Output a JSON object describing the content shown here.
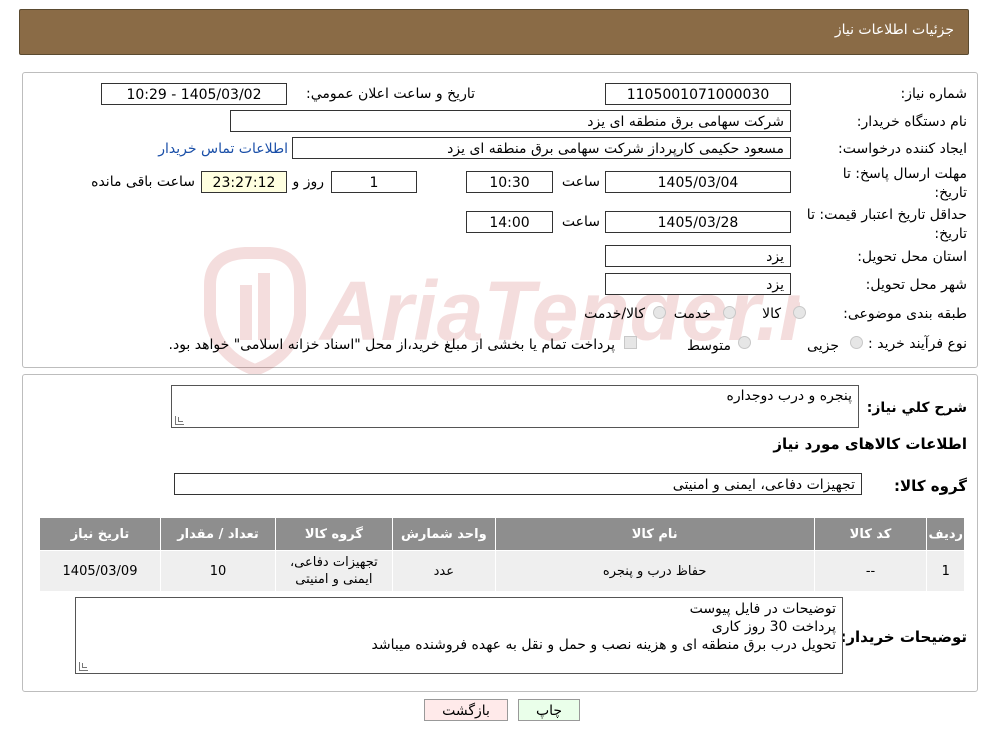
{
  "header": {
    "title": "جزئیات اطلاعات نیاز"
  },
  "form": {
    "need_number_label": "شماره نیاز:",
    "need_number": "1105001071000030",
    "announce_label": "تاريخ و ساعت اعلان عمومي:",
    "announce_value": "1405/03/02 - 10:29",
    "buyer_org_label": "نام دستگاه خریدار:",
    "buyer_org": "شرکت سهامی برق منطقه ای یزد",
    "creator_label": "ایجاد کننده درخواست:",
    "creator": "مسعود حکیمی کارپرداز شرکت سهامی برق منطقه ای یزد",
    "contact_link": "اطلاعات تماس خریدار",
    "deadline_label": "مهلت ارسال پاسخ: تا تاریخ:",
    "deadline_date": "1405/03/04",
    "time_label": "ساعت",
    "deadline_time": "10:30",
    "remaining_days": "1",
    "day_and_label": "روز و",
    "remaining_time": "23:27:12",
    "remaining_label": "ساعت باقی مانده",
    "price_validity_label": "حداقل تاریخ اعتبار قیمت: تا تاریخ:",
    "price_validity_date": "1405/03/28",
    "price_validity_time": "14:00",
    "province_label": "استان محل تحویل:",
    "province": "یزد",
    "city_label": "شهر محل تحویل:",
    "city": "یزد",
    "category_label": "طبقه بندی موضوعی:",
    "category_options": [
      "کالا",
      "خدمت",
      "کالا/خدمت"
    ],
    "process_label": "نوع فرآیند خرید :",
    "process_options": [
      "جزیی",
      "متوسط"
    ],
    "payment_note": "پرداخت تمام یا بخشی از مبلغ خرید،از محل \"اسناد خزانه اسلامی\" خواهد بود."
  },
  "details": {
    "summary_label": "شرح كلي نياز:",
    "summary": "پنجره و درب دوجداره",
    "goods_info_title": "اطلاعات کالاهای مورد نیاز",
    "goods_group_label": "گروه کالا:",
    "goods_group": "تجهیزات دفاعی، ایمنی و امنیتی"
  },
  "table": {
    "headers": [
      "ردیف",
      "کد کالا",
      "نام کالا",
      "واحد شمارش",
      "گروه کالا",
      "تعداد / مقدار",
      "تاریخ نیاز"
    ],
    "rows": [
      [
        "1",
        "--",
        "حفاظ درب و پنجره",
        "عدد",
        "تجهیزات دفاعی، ایمنی و امنیتی",
        "10",
        "1405/03/09"
      ]
    ]
  },
  "buyer_notes": {
    "label": "توضیحات خریدار:",
    "lines": [
      "توضیحات در فایل پیوست",
      "پرداخت 30 روز کاری",
      "تحویل درب برق منطقه ای و هزینه نصب و حمل و نقل به عهده فروشنده میباشد"
    ]
  },
  "buttons": {
    "print": "چاپ",
    "back": "بازگشت"
  },
  "watermark": {
    "text": "AriaTender.neT"
  },
  "colors": {
    "header_bg": "#8a6b46",
    "table_header_bg": "#8e8e8e",
    "remaining_bg": "#ffffe0",
    "print_bg": "#eaffea",
    "back_bg": "#ffeaea",
    "link": "#1a4fa8"
  }
}
